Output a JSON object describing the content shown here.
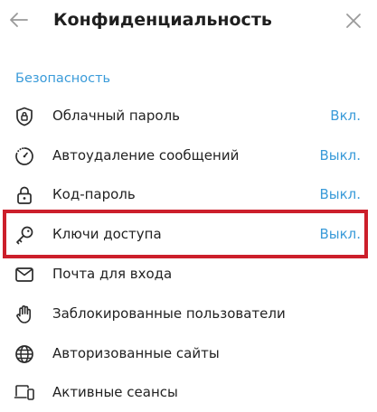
{
  "header": {
    "title": "Конфиденциальность",
    "back_icon": "arrow-left-icon",
    "close_icon": "close-icon"
  },
  "section": {
    "title": "Безопасность"
  },
  "items": [
    {
      "icon": "shield-lock-icon",
      "label": "Облачный пароль",
      "value": "Вкл."
    },
    {
      "icon": "timer-icon",
      "label": "Автоудаление сообщений",
      "value": "Выкл."
    },
    {
      "icon": "lock-icon",
      "label": "Код-пароль",
      "value": "Выкл."
    },
    {
      "icon": "key-icon",
      "label": "Ключи доступа",
      "value": "Выкл."
    },
    {
      "icon": "mail-icon",
      "label": "Почта для входа",
      "value": ""
    },
    {
      "icon": "hand-icon",
      "label": "Заблокированные пользователи",
      "value": ""
    },
    {
      "icon": "globe-icon",
      "label": "Авторизованные сайты",
      "value": ""
    },
    {
      "icon": "devices-icon",
      "label": "Активные сеансы",
      "value": ""
    }
  ],
  "colors": {
    "accent": "#3a9bd9",
    "highlight_border": "#cc1f2b",
    "icon": "#2b2b2b"
  }
}
